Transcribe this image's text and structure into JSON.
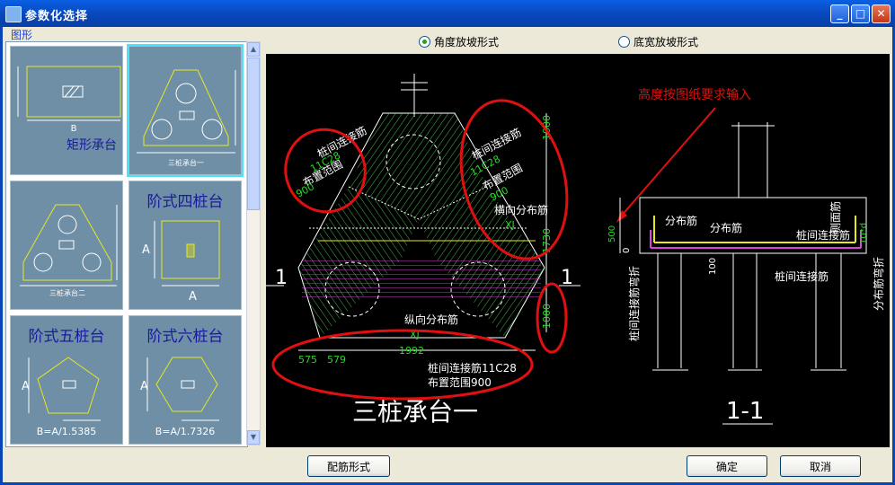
{
  "window": {
    "title": "参数化选择"
  },
  "group_label": "图形",
  "thumbnails": [
    {
      "label": "矩形承台",
      "sub": "B"
    },
    {
      "label": "三桩承台一"
    },
    {
      "label": "三桩承台二"
    },
    {
      "label": "阶式四桩台",
      "dim": "A"
    },
    {
      "label": "阶式五桩台",
      "dim": "A",
      "formula": "B=A/1.5385"
    },
    {
      "label": "阶式六桩台",
      "dim": "A",
      "formula": "B=A/1.7326"
    }
  ],
  "radio_options": [
    {
      "label": "角度放坡形式",
      "checked": true
    },
    {
      "label": "底宽放坡形式",
      "checked": false
    }
  ],
  "drawing": {
    "annotation": "高度按图纸要求输入",
    "left_labels": {
      "zhuangjian": "桩间连接筋",
      "c28a": "11C28",
      "buzhi": "布置范围",
      "n900": "900",
      "hengxiang": "横向分布筋",
      "xj": "XJ",
      "zongxiang": "纵向分布筋",
      "n1992": "1992",
      "n575": "575",
      "n579": "579",
      "bottom_conn": "桩间连接筋11C28",
      "bottom_range": "布置范围900",
      "n1000a": "1000",
      "n1730": "1730",
      "n1000b": "1000",
      "section_mark": "1",
      "title": "三桩承台一"
    },
    "right_labels": {
      "fenbu1": "分布筋",
      "fenbu2": "分布筋",
      "cemian": "侧面筋",
      "zhuangjian": "桩间连接筋",
      "zhuangjian2": "桩间连接筋",
      "n500": "500",
      "n0": "0",
      "n100": "100",
      "wanzhe": "桩间连接筋弯折",
      "fenbuwan": "分布筋弯折",
      "n10d": "10*d",
      "title": "1-1"
    }
  },
  "buttons": {
    "peijin": "配筋形式",
    "ok": "确定",
    "cancel": "取消"
  },
  "colors": {
    "title_bar": "#0846B8",
    "canvas": "#000000",
    "annotation_red": "#E01010",
    "dim_green": "#22DD22",
    "hatch_green": "#55E055",
    "magenta": "#E040E0",
    "yellow": "#E8E820"
  }
}
